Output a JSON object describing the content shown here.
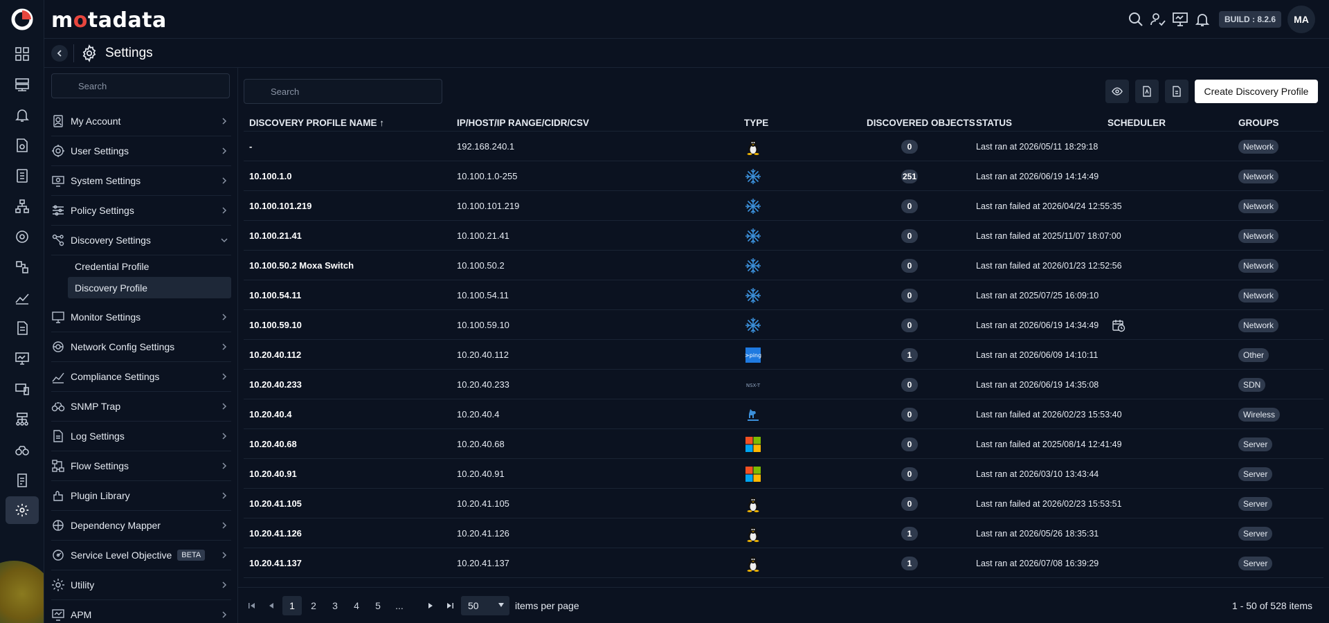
{
  "app": {
    "brand_pre": "m",
    "brand_o": "o",
    "brand_post": "tadata",
    "build": "BUILD : 8.2.6",
    "avatar": "MA"
  },
  "page": {
    "title": "Settings"
  },
  "sidebar": {
    "search_placeholder": "Search",
    "items": [
      {
        "label": "My Account",
        "icon": "account-icon"
      },
      {
        "label": "User Settings",
        "icon": "user-settings-icon"
      },
      {
        "label": "System Settings",
        "icon": "system-settings-icon"
      },
      {
        "label": "Policy Settings",
        "icon": "sliders-icon"
      },
      {
        "label": "Discovery Settings",
        "icon": "discovery-icon",
        "expanded": true,
        "children": [
          {
            "label": "Credential Profile"
          },
          {
            "label": "Discovery Profile",
            "active": true
          }
        ]
      },
      {
        "label": "Monitor Settings",
        "icon": "monitor-icon"
      },
      {
        "label": "Network Config Settings",
        "icon": "network-config-icon"
      },
      {
        "label": "Compliance Settings",
        "icon": "compliance-icon"
      },
      {
        "label": "SNMP Trap",
        "icon": "binoculars-icon"
      },
      {
        "label": "Log Settings",
        "icon": "log-icon"
      },
      {
        "label": "Flow Settings",
        "icon": "flow-icon"
      },
      {
        "label": "Plugin Library",
        "icon": "plugin-icon"
      },
      {
        "label": "Dependency Mapper",
        "icon": "dependency-icon"
      },
      {
        "label": "Service Level Objective",
        "icon": "slo-icon",
        "badge": "BETA"
      },
      {
        "label": "Utility",
        "icon": "utility-icon"
      },
      {
        "label": "APM",
        "icon": "apm-icon"
      }
    ]
  },
  "main": {
    "search_placeholder": "Search",
    "create_label": "Create Discovery Profile",
    "columns": {
      "name": "DISCOVERY PROFILE NAME ↑",
      "ip": "IP/HOST/IP RANGE/CIDR/CSV",
      "type": "TYPE",
      "objects": "DISCOVERED OBJECTS",
      "status": "STATUS",
      "scheduler": "SCHEDULER",
      "groups": "GROUPS"
    },
    "rows": [
      {
        "name": "-",
        "ip": "192.168.240.1",
        "type": "linux-icon",
        "count": "0",
        "status": "Last ran at 2026/05/11 18:29:18",
        "sched": false,
        "group": "Network"
      },
      {
        "name": "10.100.1.0",
        "ip": "10.100.1.0-255",
        "type": "snowflake-icon",
        "count": "251",
        "status": "Last ran at 2026/06/19 14:14:49",
        "sched": false,
        "group": "Network"
      },
      {
        "name": "10.100.101.219",
        "ip": "10.100.101.219",
        "type": "snowflake-icon",
        "count": "0",
        "status": "Last ran failed at 2026/04/24 12:55:35",
        "sched": false,
        "group": "Network"
      },
      {
        "name": "10.100.21.41",
        "ip": "10.100.21.41",
        "type": "snowflake-icon",
        "count": "0",
        "status": "Last ran failed at 2025/11/07 18:07:00",
        "sched": false,
        "group": "Network"
      },
      {
        "name": "10.100.50.2 Moxa Switch",
        "ip": "10.100.50.2",
        "type": "snowflake-icon",
        "count": "0",
        "status": "Last ran failed at 2026/01/23 12:52:56",
        "sched": false,
        "group": "Network"
      },
      {
        "name": "10.100.54.11",
        "ip": "10.100.54.11",
        "type": "snowflake-icon",
        "count": "0",
        "status": "Last ran at 2025/07/25 16:09:10",
        "sched": false,
        "group": "Network"
      },
      {
        "name": "10.100.59.10",
        "ip": "10.100.59.10",
        "type": "snowflake-icon",
        "count": "0",
        "status": "Last ran at 2026/06/19 14:34:49",
        "sched": true,
        "group": "Network"
      },
      {
        "name": "10.20.40.112",
        "ip": "10.20.40.112",
        "type": "ping-icon",
        "count": "1",
        "status": "Last ran at 2026/06/09 14:10:11",
        "sched": false,
        "group": "Other"
      },
      {
        "name": "10.20.40.233",
        "ip": "10.20.40.233",
        "type": "nsx-icon",
        "count": "0",
        "status": "Last ran at 2026/06/19 14:35:08",
        "sched": false,
        "group": "SDN"
      },
      {
        "name": "10.20.40.4",
        "ip": "10.20.40.4",
        "type": "ruckus-icon",
        "count": "0",
        "status": "Last ran failed at 2026/02/23 15:53:40",
        "sched": false,
        "group": "Wireless"
      },
      {
        "name": "10.20.40.68",
        "ip": "10.20.40.68",
        "type": "windows-icon",
        "count": "0",
        "status": "Last ran failed at 2025/08/14 12:41:49",
        "sched": false,
        "group": "Server"
      },
      {
        "name": "10.20.40.91",
        "ip": "10.20.40.91",
        "type": "windows-icon",
        "count": "0",
        "status": "Last ran at 2026/03/10 13:43:44",
        "sched": false,
        "group": "Server"
      },
      {
        "name": "10.20.41.105",
        "ip": "10.20.41.105",
        "type": "linux-icon",
        "count": "0",
        "status": "Last ran failed at 2026/02/23 15:53:51",
        "sched": false,
        "group": "Server"
      },
      {
        "name": "10.20.41.126",
        "ip": "10.20.41.126",
        "type": "linux-icon",
        "count": "1",
        "status": "Last ran at 2026/05/26 18:35:31",
        "sched": false,
        "group": "Server"
      },
      {
        "name": "10.20.41.137",
        "ip": "10.20.41.137",
        "type": "linux-icon",
        "count": "1",
        "status": "Last ran at 2026/07/08 16:39:29",
        "sched": false,
        "group": "Server"
      }
    ]
  },
  "pager": {
    "pages": [
      "1",
      "2",
      "3",
      "4",
      "5",
      "..."
    ],
    "current": "1",
    "per_page": "50",
    "per_page_label": "items per page",
    "summary": "1 - 50 of 528 items"
  }
}
